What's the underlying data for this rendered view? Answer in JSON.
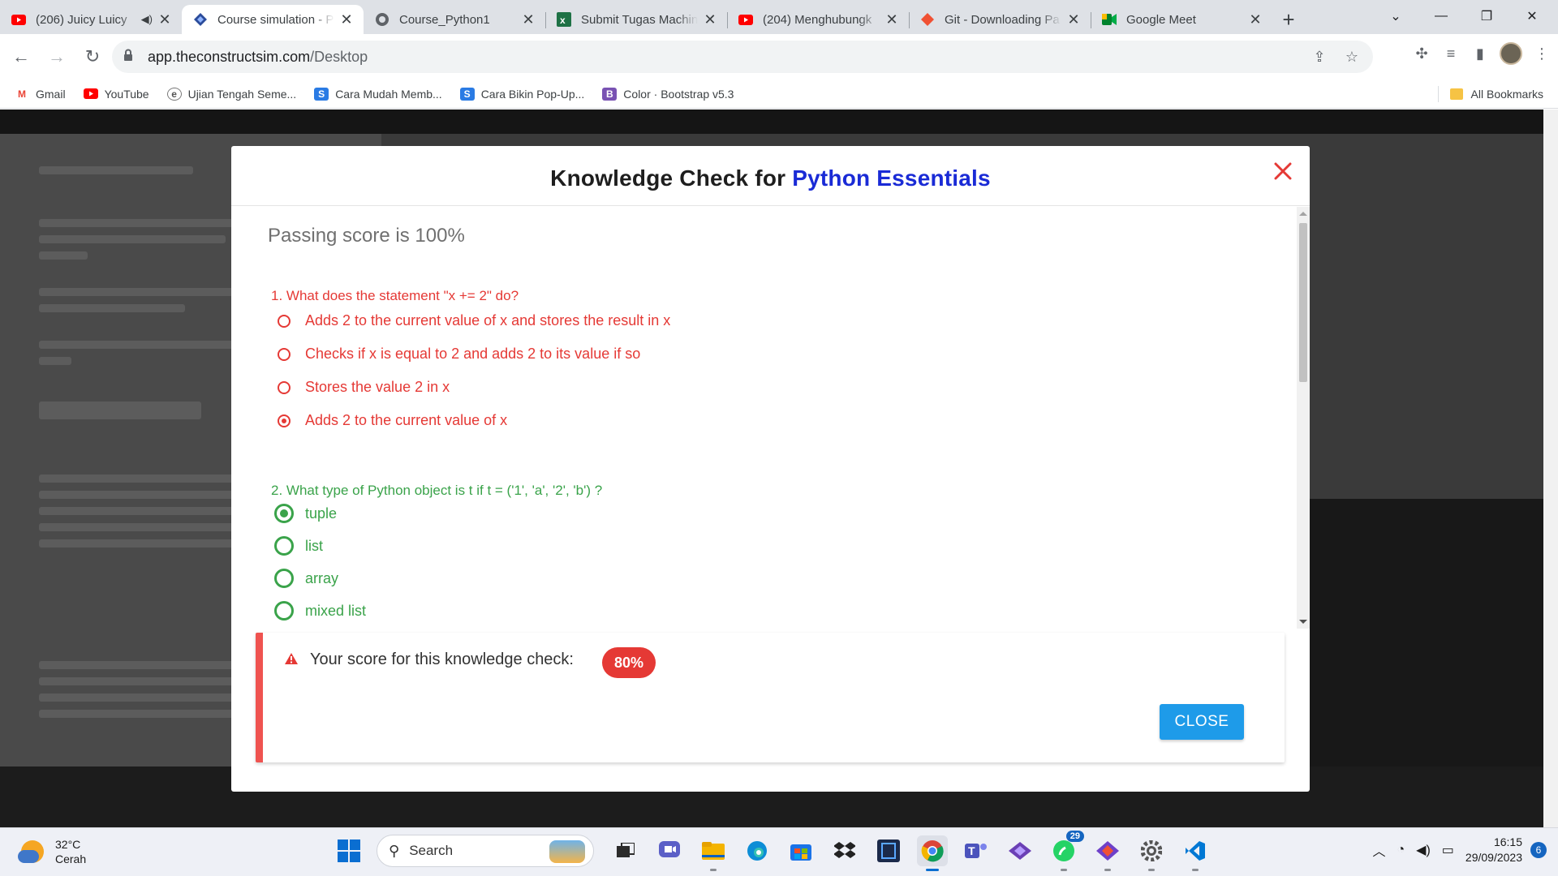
{
  "browser": {
    "tabs": [
      {
        "title": "(206) Juicy Luicy",
        "icon": "youtube-icon",
        "audio": true,
        "active": false
      },
      {
        "title": "Course simulation - P",
        "icon": "constructsim-icon",
        "active": true
      },
      {
        "title": "Course_Python1",
        "icon": "globe-icon",
        "active": false
      },
      {
        "title": "Submit Tugas Machin",
        "icon": "excel-icon",
        "active": false
      },
      {
        "title": "(204) Menghubungk",
        "icon": "youtube-icon",
        "active": false
      },
      {
        "title": "Git - Downloading Pa",
        "icon": "git-icon",
        "active": false
      },
      {
        "title": "Google Meet",
        "icon": "meet-icon",
        "active": false
      }
    ],
    "address": {
      "domain": "app.theconstructsim.com",
      "path": "/Desktop"
    },
    "bookmarks": [
      {
        "label": "Gmail",
        "icon": "gmail-icon"
      },
      {
        "label": "YouTube",
        "icon": "youtube-icon"
      },
      {
        "label": "Ujian Tengah Seme...",
        "icon": "e-icon"
      },
      {
        "label": "Cara Mudah Memb...",
        "icon": "s-icon"
      },
      {
        "label": "Cara Bikin Pop-Up...",
        "icon": "s-icon"
      },
      {
        "label": "Color · Bootstrap v5.3",
        "icon": "bootstrap-icon"
      }
    ],
    "all_bookmarks": "All Bookmarks"
  },
  "modal": {
    "title_prefix": "Knowledge Check for ",
    "title_course": "Python Essentials",
    "passing": "Passing score is 100%",
    "questions": [
      {
        "text": "1. What does the statement \"x += 2\" do?",
        "status": "incorrect",
        "options": [
          {
            "text": "Adds 2 to the current value of x and stores the result in x",
            "selected": false
          },
          {
            "text": "Checks if x is equal to 2 and adds 2 to its value if so",
            "selected": false
          },
          {
            "text": "Stores the value 2 in x",
            "selected": false
          },
          {
            "text": "Adds 2 to the current value of x",
            "selected": true
          }
        ]
      },
      {
        "text": "2. What type of Python object is t if t = ('1', 'a', '2', 'b') ?",
        "status": "correct",
        "options": [
          {
            "text": "tuple",
            "selected": true
          },
          {
            "text": "list",
            "selected": false
          },
          {
            "text": "array",
            "selected": false
          },
          {
            "text": "mixed list",
            "selected": false
          }
        ]
      }
    ],
    "score_label": "Your score for this knowledge check:",
    "score_value": "80%",
    "close_label": "CLOSE"
  },
  "taskbar": {
    "weather_temp": "32°C",
    "weather_desc": "Cerah",
    "search_label": "Search",
    "whatsapp_badge": "29",
    "time": "16:15",
    "date": "29/09/2023",
    "notification_count": "6"
  },
  "colors": {
    "incorrect": "#e53935",
    "correct": "#3aa34a",
    "title_blue": "#1a2bd6",
    "close_button": "#1e9be9"
  }
}
